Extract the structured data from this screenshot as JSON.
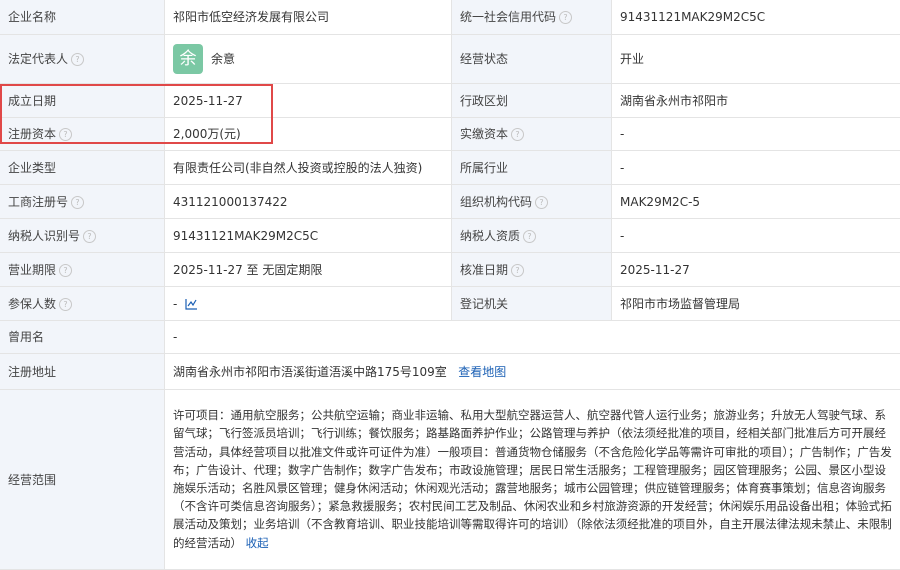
{
  "labels": {
    "company_name": "企业名称",
    "credit_code": "统一社会信用代码",
    "legal_rep": "法定代表人",
    "status": "经营状态",
    "founded": "成立日期",
    "region": "行政区划",
    "reg_capital": "注册资本",
    "paid_capital": "实缴资本",
    "company_type": "企业类型",
    "industry": "所属行业",
    "reg_no": "工商注册号",
    "org_code": "组织机构代码",
    "taxpayer_id": "纳税人识别号",
    "taxpayer_qual": "纳税人资质",
    "term": "营业期限",
    "approval_date": "核准日期",
    "insured": "参保人数",
    "authority": "登记机关",
    "former_name": "曾用名",
    "address": "注册地址",
    "scope": "经营范围"
  },
  "values": {
    "company_name": "祁阳市低空经济发展有限公司",
    "credit_code": "91431121MAK29M2C5C",
    "legal_rep_avatar": "余",
    "legal_rep": "余意",
    "status": "开业",
    "founded": "2025-11-27",
    "region": "湖南省永州市祁阳市",
    "reg_capital": "2,000万(元)",
    "paid_capital": "-",
    "company_type": "有限责任公司(非自然人投资或控股的法人独资)",
    "industry": "-",
    "reg_no": "431121000137422",
    "org_code": "MAK29M2C-5",
    "taxpayer_id": "91431121MAK29M2C5C",
    "taxpayer_qual": "-",
    "term": "2025-11-27 至 无固定期限",
    "approval_date": "2025-11-27",
    "insured": "-",
    "authority": "祁阳市市场监督管理局",
    "former_name": "-",
    "address": "湖南省永州市祁阳市浯溪街道浯溪中路175号109室",
    "address_link": "查看地图",
    "scope": "许可项目：通用航空服务；公共航空运输；商业非运输、私用大型航空器运营人、航空器代管人运行业务；旅游业务；升放无人驾驶气球、系留气球；飞行签派员培训；飞行训练；餐饮服务；路基路面养护作业；公路管理与养护（依法须经批准的项目，经相关部门批准后方可开展经营活动，具体经营项目以批准文件或许可证件为准）一般项目：普通货物仓储服务（不含危险化学品等需许可审批的项目）；广告制作；广告发布；广告设计、代理；数字广告制作；数字广告发布；市政设施管理；居民日常生活服务；工程管理服务；园区管理服务；公园、景区小型设施娱乐活动；名胜风景区管理；健身休闲活动；休闲观光活动；露营地服务；城市公园管理；供应链管理服务；体育赛事策划；信息咨询服务（不含许可类信息咨询服务）；紧急救援服务；农村民间工艺及制品、休闲农业和乡村旅游资源的开发经营；休闲娱乐用品设备出租；体验式拓展活动及策划；业务培训（不含教育培训、职业技能培训等需取得许可的培训）（除依法须经批准的项目外，自主开展法律法规未禁止、未限制的经营活动）",
    "scope_link": "收起"
  },
  "help_glyph": "?",
  "colors": {
    "label_bg": "#f2f5fa",
    "link": "#1a5fb4",
    "highlight": "#e04848",
    "avatar": "#7bc8a4"
  },
  "icons": {
    "help": "help-circle-icon",
    "trend": "trend-chart-icon"
  }
}
